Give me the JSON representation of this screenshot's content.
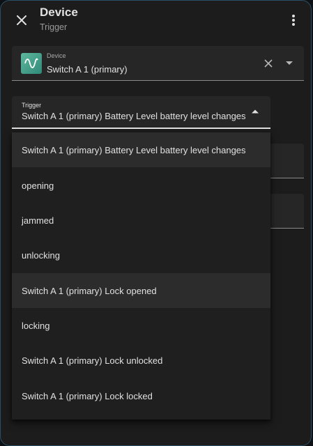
{
  "header": {
    "title": "Device",
    "subtitle": "Trigger"
  },
  "device_field": {
    "label": "Device",
    "value": "Switch A 1 (primary)"
  },
  "trigger_field": {
    "label": "Trigger",
    "value": "Switch A 1 (primary) Battery Level battery level changes"
  },
  "dropdown": {
    "options": [
      {
        "label": "Switch A 1 (primary) Battery Level battery level changes",
        "highlighted": true
      },
      {
        "label": "opening",
        "highlighted": false
      },
      {
        "label": "jammed",
        "highlighted": false
      },
      {
        "label": "unlocking",
        "highlighted": false
      },
      {
        "label": "Switch A 1 (primary) Lock opened",
        "highlighted": true
      },
      {
        "label": "locking",
        "highlighted": false
      },
      {
        "label": "Switch A 1 (primary) Lock unlocked",
        "highlighted": false
      },
      {
        "label": "Switch A 1 (primary) Lock locked",
        "highlighted": false
      }
    ]
  },
  "icons": {
    "close": "close-icon",
    "menu": "dots-vertical-icon",
    "device": "sine-wave-icon",
    "clear": "clear-icon",
    "device_dropdown": "caret-down-icon",
    "trigger_dropdown": "caret-up-icon"
  },
  "colors": {
    "dialog_bg": "#1c1c1c",
    "field_bg": "#262626",
    "menu_bg": "#1f1f1f",
    "highlight_bg": "#2c2c2c",
    "text": "#e1e1e1",
    "muted_text": "#9b9b9b",
    "device_badge": "#4ea58e",
    "dialog_border": "#2a4f66"
  }
}
